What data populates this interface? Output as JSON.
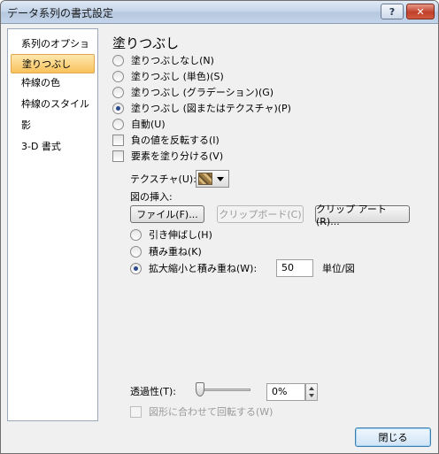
{
  "window": {
    "title": "データ系列の書式設定",
    "help": "?",
    "close": "✕"
  },
  "sidebar": {
    "items": [
      {
        "label": "系列のオプション"
      },
      {
        "label": "塗りつぶし",
        "selected": true
      },
      {
        "label": "枠線の色"
      },
      {
        "label": "枠線のスタイル"
      },
      {
        "label": "影"
      },
      {
        "label": "3-D 書式"
      }
    ]
  },
  "fill": {
    "title": "塗りつぶし",
    "options": [
      {
        "label": "塗りつぶしなし(N)",
        "checked": false
      },
      {
        "label": "塗りつぶし (単色)(S)",
        "checked": false
      },
      {
        "label": "塗りつぶし (グラデーション)(G)",
        "checked": false
      },
      {
        "label": "塗りつぶし (図またはテクスチャ)(P)",
        "checked": true
      },
      {
        "label": "自動(U)",
        "checked": false
      }
    ],
    "invert_negative": {
      "label": "負の値を反転する(I)",
      "checked": false
    },
    "vary_colors": {
      "label": "要素を塗り分ける(V)",
      "checked": false
    },
    "texture_label": "テクスチャ(U):",
    "insert_from_label": "図の挿入:",
    "file_button": "ファイル(F)...",
    "clipboard_button": "クリップボード(C)",
    "clipart_button": "クリップ アート(R)...",
    "picture_options": [
      {
        "label": "引き伸ばし(H)",
        "checked": false
      },
      {
        "label": "積み重ね(K)",
        "checked": false
      },
      {
        "label": "拡大縮小と積み重ね(W):",
        "checked": true
      }
    ],
    "stack_units_value": "50",
    "units_label": "単位/図",
    "transparency_label": "透過性(T):",
    "transparency_value": "0%",
    "transparency_level": 0,
    "rotate_with_shape": {
      "label": "図形に合わせて回転する(W)",
      "checked": false
    }
  },
  "footer": {
    "close_button": "閉じる"
  },
  "colors": {
    "selected_start": "#fde8b0",
    "selected_end": "#f9c25c",
    "radio_dot": "#2a4a8c"
  }
}
